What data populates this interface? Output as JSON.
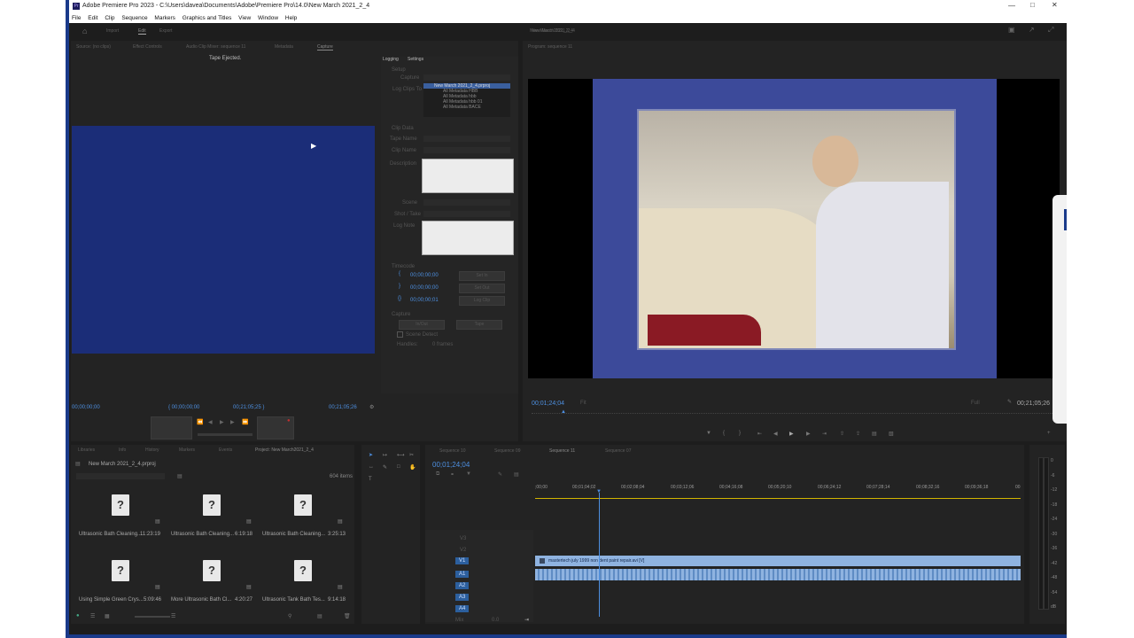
{
  "window": {
    "title": "Adobe Premiere Pro 2023 - C:\\Users\\davea\\Documents\\Adobe\\Premiere Pro\\14.0\\New March 2021_2_4",
    "app_icon": "Pr"
  },
  "menu": [
    "File",
    "Edit",
    "Clip",
    "Sequence",
    "Markers",
    "Graphics and Titles",
    "View",
    "Window",
    "Help"
  ],
  "workspace_tabs": [
    "Import",
    "Edit",
    "Export"
  ],
  "sequence_name": "New March 2021_2_4",
  "source_tabs": [
    "Source: (no clips)",
    "Effect Controls",
    "Audio Clip Mixer: sequence 11",
    "Metadata",
    "Capture"
  ],
  "capture": {
    "status": "Tape Ejected.",
    "logging_tab": "Logging",
    "settings_tab": "Settings",
    "setup": "Setup",
    "capture_label": "Capture",
    "log_clips_to": "Log Clips To",
    "bins": [
      "New March 2021_2_4.prproj",
      "All Metadata HBB",
      "All Metadata hbb",
      "All Metadata hbb 01",
      "All Metadata BACE"
    ],
    "clip_data": "Clip Data",
    "tape_name": "Tape Name",
    "clip_name": "Clip Name",
    "description": "Description",
    "scene": "Scene",
    "shot_take": "Shot / Take",
    "log_note": "Log Note",
    "timecode": "Timecode",
    "tc_in": "00;00;00;00",
    "tc_out": "00;00;00;00",
    "tc_dur": "00;00;00;01",
    "set_in": "Set In",
    "set_out": "Set Out",
    "log_clip": "Log Clip",
    "capture_section": "Capture",
    "in_out": "In/Out",
    "tape": "Tape",
    "scene_detect": "Scene Detect",
    "handles": "Handles:",
    "frames": "0 frames",
    "tc_left": "00;00;00;00",
    "tc_mid_a": "{ 00;00;00;00",
    "tc_mid_b": "00;21;05;25 }",
    "tc_right": "00;21;05;26"
  },
  "program": {
    "title": "Program: sequence 11",
    "seq_tab": "New March 2021_2_4",
    "timecode": "00;01;24;04",
    "fit": "Fit",
    "quality": "Full",
    "duration": "00;21;05;26"
  },
  "project": {
    "tabs": [
      "Libraries",
      "Info",
      "History",
      "Markers",
      "Events",
      "Project: New March2021_2_4"
    ],
    "name": "New March 2021_2_4.prproj",
    "item_count": "604 items",
    "items": [
      {
        "name": "Ultrasonic Bath Cleaning...",
        "dur": "11:23:19"
      },
      {
        "name": "Ultrasonic Bath Cleaning...",
        "dur": "6:19:18"
      },
      {
        "name": "Ultrasonic Bath Cleaning...",
        "dur": "3:25:13"
      },
      {
        "name": "Using Simple Green Crys...",
        "dur": "5:09:46"
      },
      {
        "name": "More Ultrasonic Bath Cl...",
        "dur": "4:20:27"
      },
      {
        "name": "Ultrasonic Tank Bath Tes...",
        "dur": "9:14:18"
      }
    ]
  },
  "timeline": {
    "tabs": [
      "Sequence 10",
      "Sequence 09",
      "Sequence 11",
      "Sequence 07"
    ],
    "timecode": "00;01;24;04",
    "ruler": [
      ";00;00",
      "00;01;04;02",
      "00;02;08;04",
      "00;03;12;06",
      "00;04;16;08",
      "00;05;20;10",
      "00;06;24;12",
      "00;07;28;14",
      "00;08;32;16",
      "00;09;36;18",
      "00"
    ],
    "video_tracks": [
      "V3",
      "V2",
      "V1"
    ],
    "audio_tracks": [
      "A1",
      "A2",
      "A3",
      "A4"
    ],
    "mix_label": "Mix",
    "mix_value": "0.0",
    "clip_label": "mastertech july 1999 non dent paint repair.avi [V]"
  },
  "meter": [
    "0",
    "-6",
    "-12",
    "-18",
    "-24",
    "-30",
    "-36",
    "-42",
    "-48",
    "-54",
    "dB"
  ]
}
